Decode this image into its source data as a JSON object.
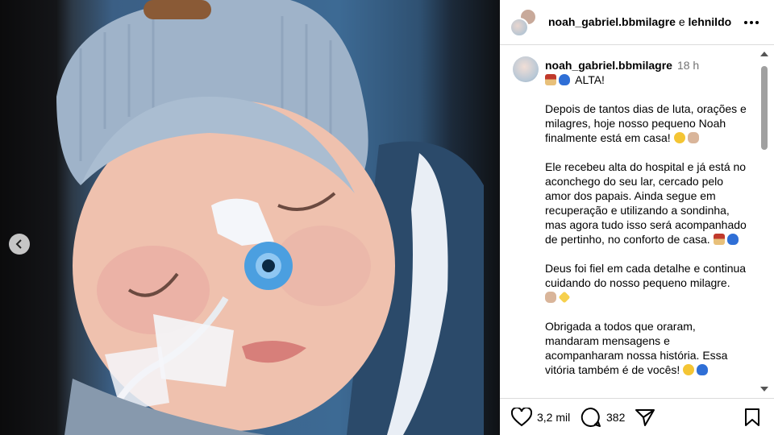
{
  "header": {
    "user1": "noah_gabriel.bbmilagre",
    "joiner": "e",
    "user2": "lehnildo"
  },
  "caption": {
    "username": "noah_gabriel.bbmilagre",
    "time": "18 h",
    "line1": "ALTA!",
    "p1": "Depois de tantos dias de luta, orações e milagres, hoje nosso pequeno Noah finalmente está em casa!",
    "p2": "Ele recebeu alta do hospital e já está no aconchego do seu lar, cercado pelo amor dos papais. Ainda segue em recuperação e utilizando a sondinha, mas agora tudo isso será acompanhado de pertinho, no conforto de casa.",
    "p3": "Deus foi fiel em cada detalhe e continua cuidando do nosso pequeno milagre.",
    "p4": "Obrigada a todos que oraram, mandaram mensagens e acompanharam nossa história. Essa vitória também é de vocês!"
  },
  "actions": {
    "likes": "3,2 mil",
    "comments": "382"
  },
  "icons": [
    "chevron-left-icon",
    "more-icon",
    "heart-icon",
    "comment-icon",
    "share-icon",
    "bookmark-icon"
  ],
  "colors": {
    "panel_bg": "#ffffff",
    "text": "#000000",
    "muted": "#737373",
    "divider": "#dbdbdb"
  }
}
